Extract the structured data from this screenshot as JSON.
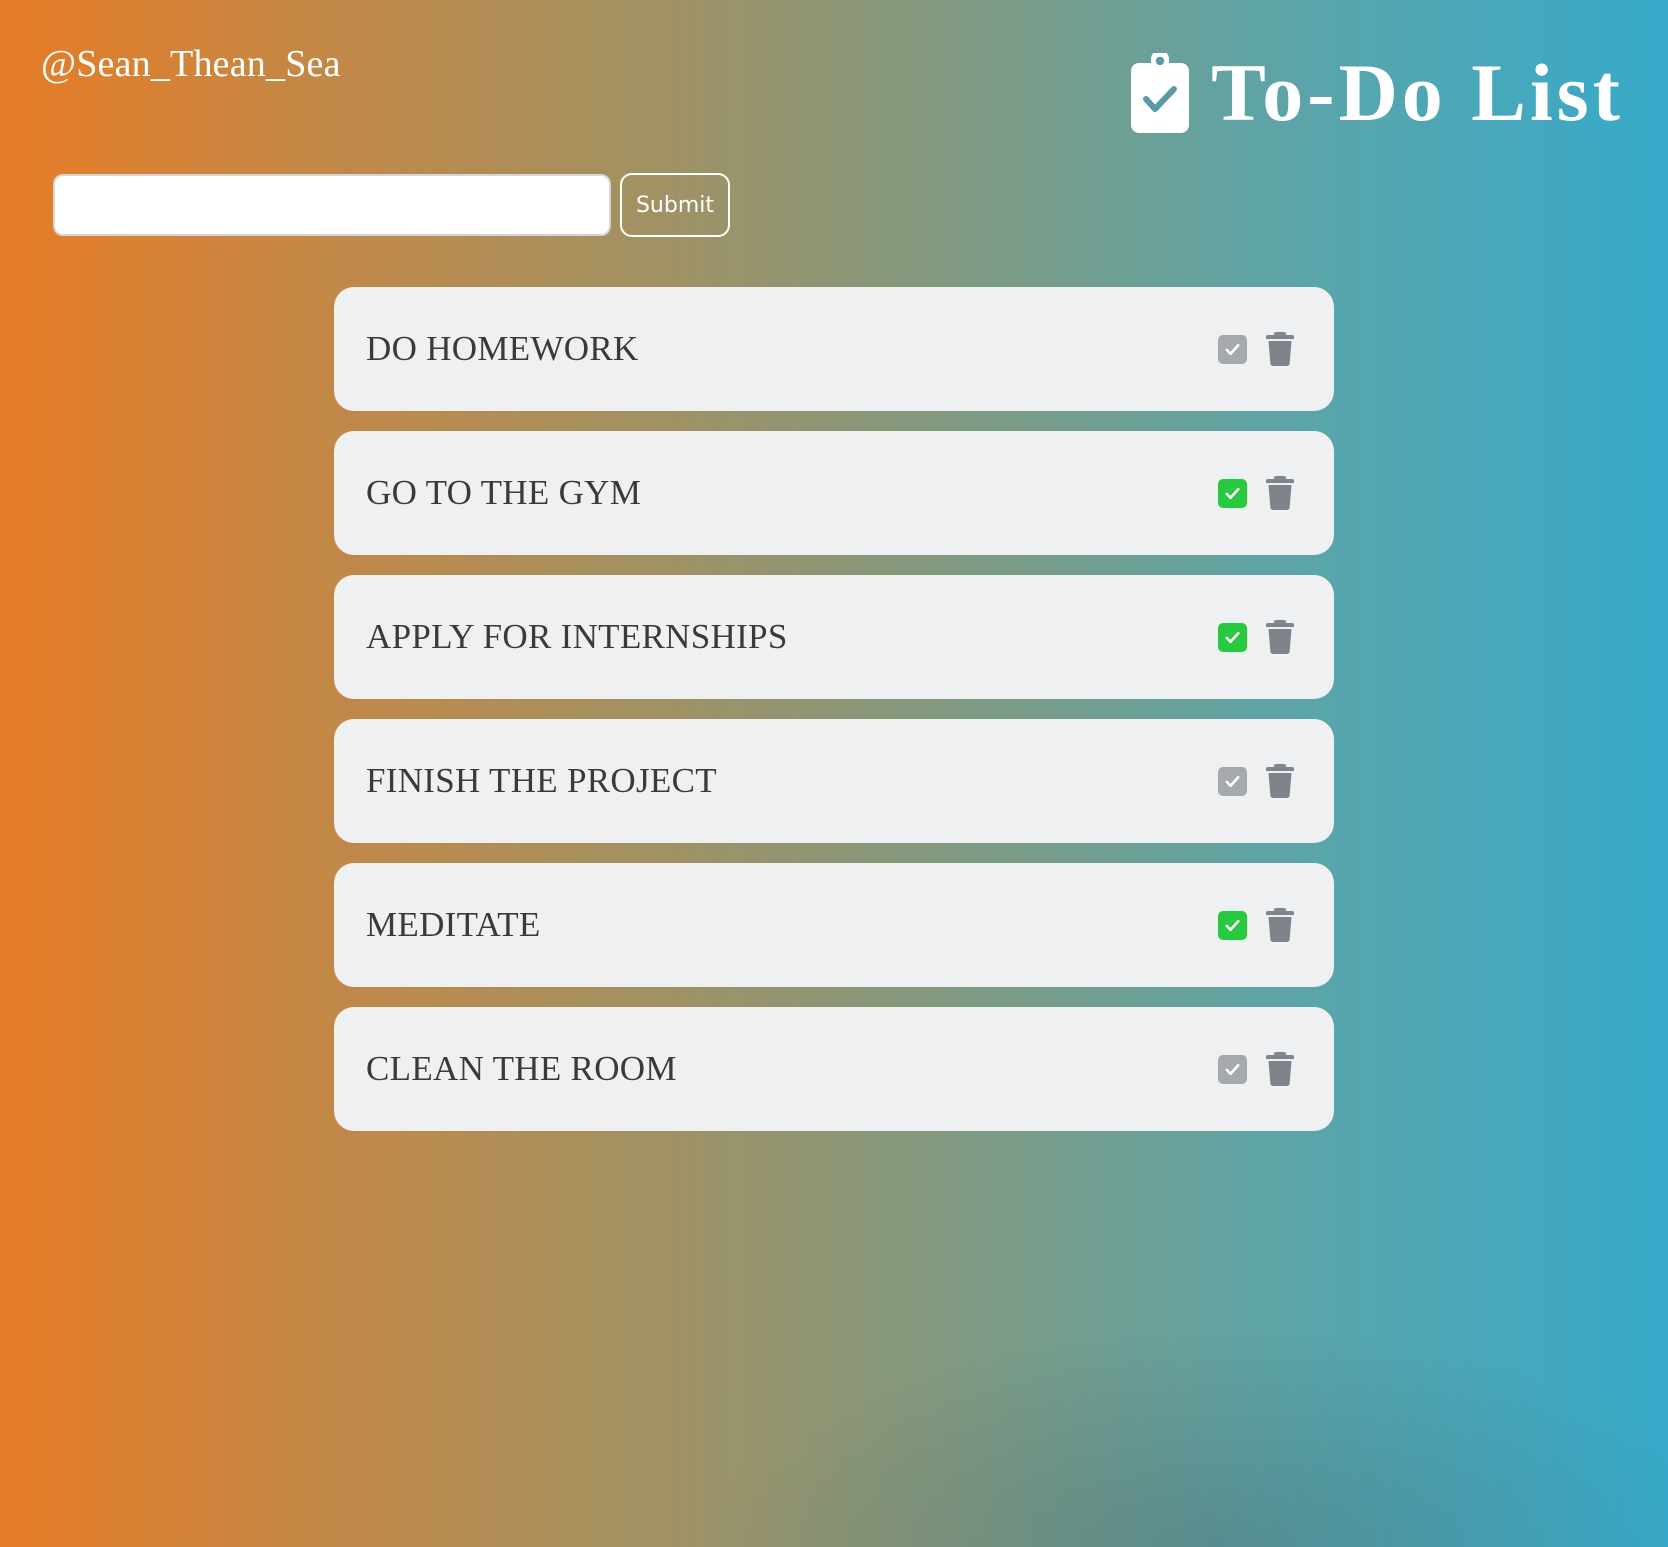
{
  "header": {
    "handle": "@Sean_Thean_Sea",
    "title": "To-Do List",
    "icon": "clipboard-check-icon"
  },
  "form": {
    "input_value": "",
    "placeholder": "",
    "submit_label": "Submit"
  },
  "todos": [
    {
      "text": "DO HOMEWORK",
      "completed": false
    },
    {
      "text": "GO TO THE GYM",
      "completed": true
    },
    {
      "text": "APPLY FOR INTERNSHIPS",
      "completed": true
    },
    {
      "text": "FINISH THE PROJECT",
      "completed": false
    },
    {
      "text": "MEDITATE",
      "completed": true
    },
    {
      "text": "CLEAN THE ROOM",
      "completed": false
    }
  ],
  "icons": {
    "check": "check-square-icon",
    "delete": "trash-icon"
  },
  "colors": {
    "gradient_start": "#e77c26",
    "gradient_end": "#37aaca",
    "item_background": "#eff0f2",
    "text": "#3a3a3a",
    "check_completed": "#27c93f",
    "check_pending": "#a5a8ad",
    "trash": "#7e848c"
  }
}
